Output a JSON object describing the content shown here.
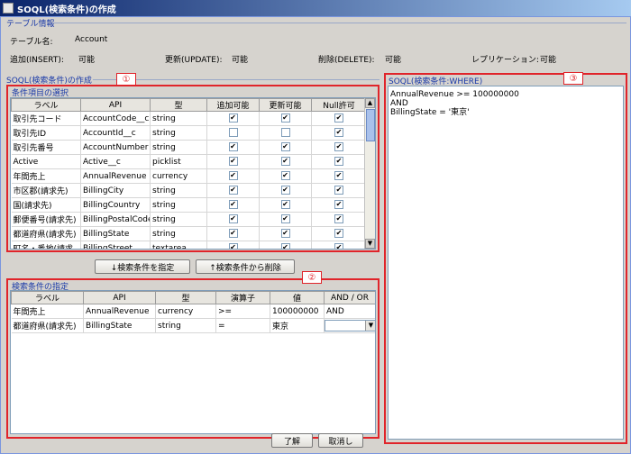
{
  "window": {
    "title": "SOQL(検索条件)の作成"
  },
  "table_info": {
    "group_title": "テーブル情報",
    "table_name_label": "テーブル名:",
    "table_name_value": "Account",
    "insert_label": "追加(INSERT):",
    "insert_value": "可能",
    "update_label": "更新(UPDATE):",
    "update_value": "可能",
    "delete_label": "削除(DELETE):",
    "delete_value": "可能",
    "replication_label": "レプリケーション:",
    "replication_value": "可能"
  },
  "soql_create": {
    "group_title": "SOQL(検索条件)の作成"
  },
  "field_selection": {
    "group_title": "条件項目の選択",
    "badge": "①",
    "columns": [
      "ラベル",
      "API",
      "型",
      "追加可能",
      "更新可能",
      "Null許可"
    ],
    "rows": [
      {
        "label": "取引先コード",
        "api": "AccountCode__c",
        "type": "string",
        "insert": true,
        "update": true,
        "nullable": true
      },
      {
        "label": "取引先ID",
        "api": "AccountId__c",
        "type": "string",
        "insert": false,
        "update": false,
        "nullable": true
      },
      {
        "label": "取引先番号",
        "api": "AccountNumber",
        "type": "string",
        "insert": true,
        "update": true,
        "nullable": true
      },
      {
        "label": "Active",
        "api": "Active__c",
        "type": "picklist",
        "insert": true,
        "update": true,
        "nullable": true
      },
      {
        "label": "年間売上",
        "api": "AnnualRevenue",
        "type": "currency",
        "insert": true,
        "update": true,
        "nullable": true
      },
      {
        "label": "市区郡(請求先)",
        "api": "BillingCity",
        "type": "string",
        "insert": true,
        "update": true,
        "nullable": true
      },
      {
        "label": "国(請求先)",
        "api": "BillingCountry",
        "type": "string",
        "insert": true,
        "update": true,
        "nullable": true
      },
      {
        "label": "郵便番号(請求先)",
        "api": "BillingPostalCode",
        "type": "string",
        "insert": true,
        "update": true,
        "nullable": true
      },
      {
        "label": "都道府県(請求先)",
        "api": "BillingState",
        "type": "string",
        "insert": true,
        "update": true,
        "nullable": true
      },
      {
        "label": "町名・番地(請求...",
        "api": "BillingStreet",
        "type": "textarea",
        "insert": true,
        "update": true,
        "nullable": true
      }
    ]
  },
  "buttons": {
    "add_condition": "↓検索条件を指定",
    "remove_condition": "↑検索条件から削除",
    "ok": "了解",
    "cancel": "取消し"
  },
  "conditions": {
    "group_title": "検索条件の指定",
    "badge": "②",
    "columns": [
      "ラベル",
      "API",
      "型",
      "演算子",
      "値",
      "AND / OR"
    ],
    "rows": [
      {
        "label": "年間売上",
        "api": "AnnualRevenue",
        "type": "currency",
        "operator": ">=",
        "value": "100000000",
        "andor": "AND"
      },
      {
        "label": "都道府県(請求先)",
        "api": "BillingState",
        "type": "string",
        "operator": "=",
        "value": "東京",
        "andor": ""
      }
    ]
  },
  "where_panel": {
    "group_title": "SOQL(検索条件:WHERE)",
    "badge": "③",
    "lines": [
      "AnnualRevenue >= 100000000",
      "AND",
      "BillingState = '東京'"
    ]
  },
  "colors": {
    "annotation_red": "#e0242a",
    "group_title_blue": "#1a3aa8",
    "titlebar_start": "#0a246a"
  }
}
